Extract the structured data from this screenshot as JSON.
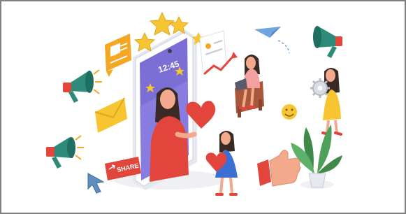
{
  "illustration": {
    "phone_clock": "12:45",
    "share_label": "SHARE",
    "colors": {
      "frame": "#808080",
      "teal": "#2e8b7a",
      "red": "#e2453c",
      "orange": "#f5a623",
      "yellow": "#f7c531",
      "purple": "#7b6fd6",
      "blue": "#3b6fd4",
      "skin": "#f2a98c",
      "hair": "#3a2a25",
      "plant": "#3f8a4a"
    },
    "icons": [
      "megaphone-icon",
      "chat-bubble-icon",
      "envelope-icon",
      "star-icon",
      "heart-icon",
      "paper-plane-icon",
      "chart-card-icon",
      "thumbs-up-icon",
      "smiley-icon",
      "cursor-icon",
      "gear-icon",
      "plant-icon",
      "smartphone-icon"
    ]
  }
}
